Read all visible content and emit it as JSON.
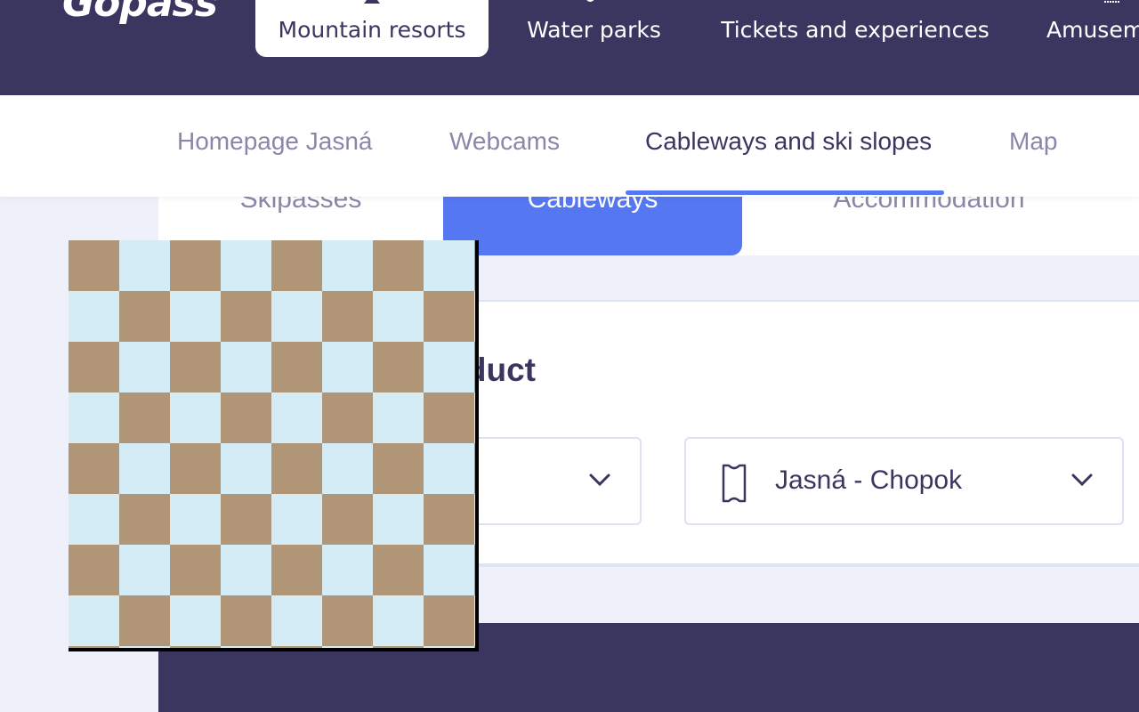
{
  "header": {
    "logo": "Gopass",
    "categories": [
      {
        "label": "Mountain resorts",
        "icon": "mountain-icon",
        "active": true
      },
      {
        "label": "Water parks",
        "icon": "wave-icon",
        "active": false
      },
      {
        "label": "Tickets and experiences",
        "icon": "ticket-icon",
        "active": false
      },
      {
        "label": "Amusement parks",
        "icon": "ferris-wheel-icon",
        "active": false
      }
    ]
  },
  "subnav": {
    "items": [
      {
        "label": "Homepage Jasná",
        "active": false
      },
      {
        "label": "Webcams",
        "active": false
      },
      {
        "label": "Cableways and ski slopes",
        "active": true
      },
      {
        "label": "Map",
        "active": false
      }
    ]
  },
  "tabs": [
    {
      "label": "Skipasses",
      "active": false
    },
    {
      "label": "Cableways",
      "active": true
    },
    {
      "label": "Accommodation",
      "active": false
    }
  ],
  "card": {
    "title": "Select a product",
    "date_select": {
      "value": ""
    },
    "resort_select": {
      "value": "Jasná - Chopok",
      "icon": "ticket-icon"
    }
  },
  "colors": {
    "navy": "#3a3660",
    "accent": "#5577f2",
    "muted_text": "#8a87a8",
    "page_bg": "#eef1f9"
  }
}
